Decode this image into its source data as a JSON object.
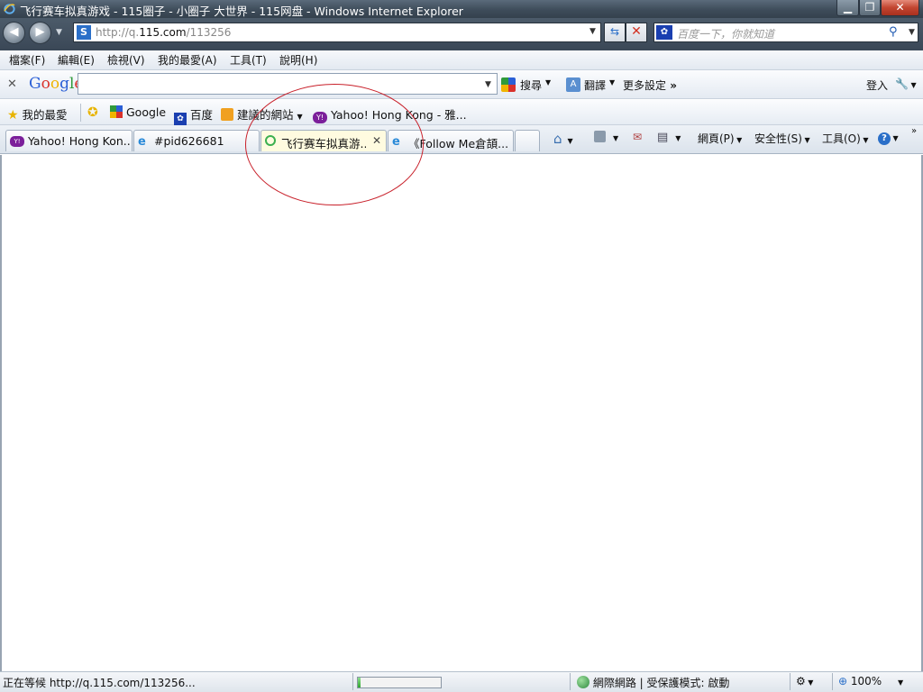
{
  "window": {
    "title": "飞行赛车拟真游戏 - 115圈子 - 小圈子 大世界 - 115网盘 - Windows Internet Explorer"
  },
  "address_bar": {
    "url_prefix": "http://q.",
    "url_domain": "115.com",
    "url_path": "/113256",
    "search_placeholder": "百度一下，你就知道"
  },
  "menu": [
    "檔案(F)",
    "編輯(E)",
    "檢視(V)",
    "我的最愛(A)",
    "工具(T)",
    "說明(H)"
  ],
  "google_toolbar": {
    "logo": "Google",
    "search_label": "搜尋",
    "translate_label": "翻譯",
    "more_settings_label": "更多設定",
    "signin_label": "登入"
  },
  "favorites_bar": {
    "favorites_label": "我的最愛",
    "links": [
      "Google",
      "百度",
      "建議的網站",
      "Yahoo! Hong Kong - 雅..."
    ]
  },
  "tabs": [
    {
      "label": "Yahoo! Hong Kon...",
      "active": false
    },
    {
      "label": "#pid626681",
      "active": false
    },
    {
      "label": "飞行赛车拟真游...",
      "active": true
    },
    {
      "label": "《Follow Me倉頡...",
      "active": false
    }
  ],
  "command_bar": {
    "page_label": "網頁(P)",
    "safety_label": "安全性(S)",
    "tools_label": "工具(O)"
  },
  "status_bar": {
    "text": "正在等候 http://q.115.com/113256...",
    "progress": 0.03,
    "zone": "網際網路 | 受保護模式: 啟動",
    "zoom": "100%"
  },
  "colors": {
    "annotation": "#c8202a",
    "titlebar": "#3e4c5a"
  }
}
